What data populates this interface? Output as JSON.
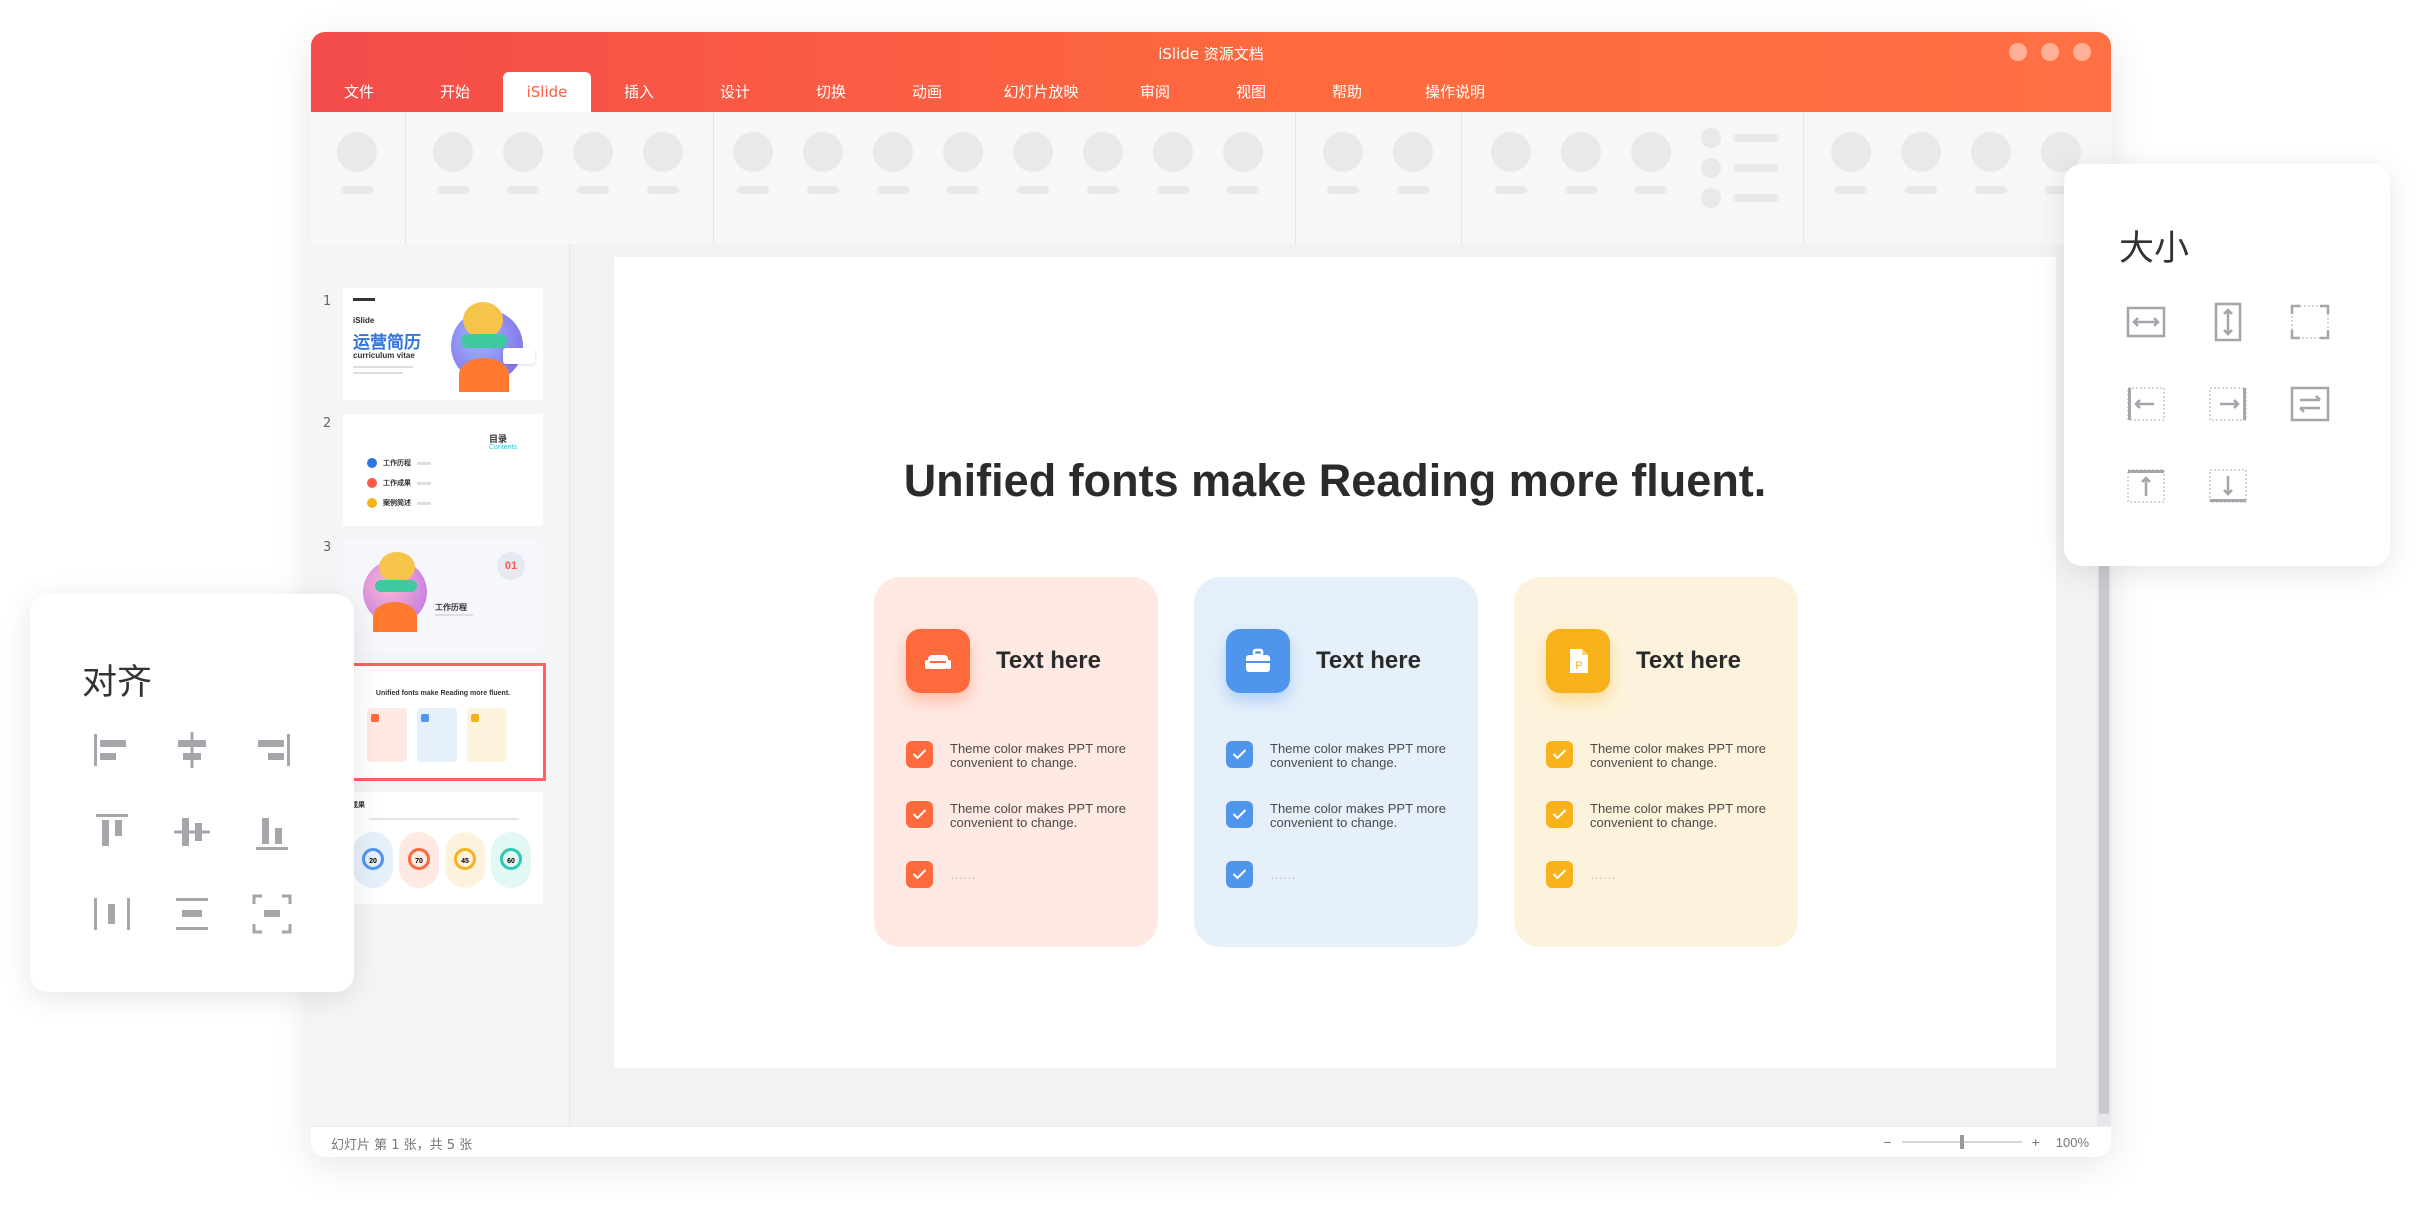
{
  "window": {
    "title": "iSlide 资源文档"
  },
  "menu": [
    {
      "label": "文件"
    },
    {
      "label": "开始"
    },
    {
      "label": "iSlide",
      "active": true
    },
    {
      "label": "插入"
    },
    {
      "label": "设计"
    },
    {
      "label": "切换"
    },
    {
      "label": "动画"
    },
    {
      "label": "幻灯片放映"
    },
    {
      "label": "审阅"
    },
    {
      "label": "视图"
    },
    {
      "label": "帮助"
    },
    {
      "label": "操作说明"
    }
  ],
  "thumbnails": [
    {
      "num": "1",
      "title": "运营简历",
      "sub": "curriculum vitae",
      "brand": "iSlide"
    },
    {
      "num": "2",
      "heading": "目录",
      "heading_en": "Contents",
      "items": [
        "工作历程",
        "工作成果",
        "案例简述"
      ]
    },
    {
      "num": "3",
      "badge": "01",
      "title": "工作历程"
    },
    {
      "num": "",
      "title": "Unified fonts make Reading more fluent."
    },
    {
      "num": "",
      "title": "成果",
      "values": [
        "20",
        "70",
        "45",
        "60"
      ]
    }
  ],
  "slide": {
    "title": "Unified fonts make Reading more fluent.",
    "cards": [
      {
        "heading": "Text here",
        "icon": "sofa-icon",
        "color": "#ff6a3d",
        "bg": "#ffe9e3",
        "items": [
          "Theme color makes PPT more convenient to change.",
          "Theme color makes PPT more convenient to change.",
          "……"
        ]
      },
      {
        "heading": "Text here",
        "icon": "briefcase-icon",
        "color": "#4f95ec",
        "bg": "#e6f0fb",
        "items": [
          "Theme color makes PPT more convenient to change.",
          "Theme color makes PPT more convenient to change.",
          "……"
        ]
      },
      {
        "heading": "Text here",
        "icon": "document-icon",
        "color": "#f7b21b",
        "bg": "#fdf3dc",
        "items": [
          "Theme color makes PPT more convenient to change.",
          "Theme color makes PPT more convenient to change.",
          "……"
        ]
      }
    ]
  },
  "status": {
    "slide_info": "幻灯片 第 1 张，共 5 张",
    "zoom": "100%",
    "zoom_minus": "−",
    "zoom_plus": "+"
  },
  "align_panel": {
    "title": "对齐"
  },
  "size_panel": {
    "title": "大小"
  },
  "colors": {
    "accent": "#ff5a44",
    "icon_gray": "#a4a6ac"
  }
}
